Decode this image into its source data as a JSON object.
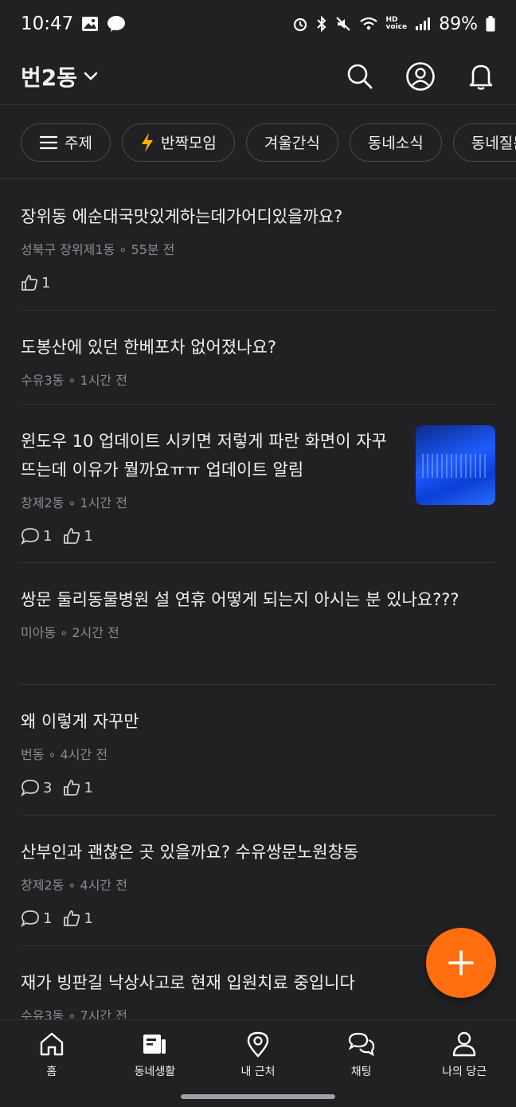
{
  "status": {
    "time": "10:47",
    "network": "HD\nvoice",
    "battery": "89%"
  },
  "header": {
    "location": "번2동"
  },
  "chips": [
    {
      "label": "주제",
      "icon": "menu-icon"
    },
    {
      "label": "반짝모임",
      "icon": "lightning-icon"
    },
    {
      "label": "겨울간식"
    },
    {
      "label": "동네소식"
    },
    {
      "label": "동네질문"
    }
  ],
  "posts": [
    {
      "title": "장위동 에순대국맛있게하는데가어디있을까요?",
      "meta": "성북구 장위제1동 ∘ 55분 전",
      "comments": "",
      "likes": "1"
    },
    {
      "title": "도봉산에 있던 한베포차 없어졌나요?",
      "meta": "수유3동 ∘ 1시간 전",
      "comments": "",
      "likes": ""
    },
    {
      "title": "윈도우 10 업데이트 시키면 저렇게 파란 화면이 자꾸 뜨는데 이유가 뭘까요ㅠㅠ 업데이트 알림",
      "meta": "창제2동 ∘ 1시간 전",
      "comments": "1",
      "likes": "1"
    },
    {
      "title": "쌍문 둘리동물병원 설 연휴 어떻게 되는지 아시는 분 있나요???",
      "meta": "미아동 ∘ 2시간 전",
      "comments": "",
      "likes": ""
    },
    {
      "title": "왜 이렇게 자꾸만",
      "meta": "번동 ∘ 4시간 전",
      "comments": "3",
      "likes": "1"
    },
    {
      "title": "산부인과 괜찮은 곳 있을까요? 수유쌍문노원창동",
      "meta": "창제2동 ∘ 4시간 전",
      "comments": "1",
      "likes": "1"
    },
    {
      "title": "재가 빙판길 낙상사고로 현재 입원치료 중입니다",
      "meta": "수유3동 ∘ 7시간 전",
      "comments": "",
      "likes": ""
    }
  ],
  "nav": [
    {
      "label": "홈"
    },
    {
      "label": "동네생활"
    },
    {
      "label": "내 근처"
    },
    {
      "label": "채팅"
    },
    {
      "label": "나의 당근"
    }
  ],
  "colors": {
    "background": "#212124",
    "accent": "#ff6f0f",
    "lightning": "#ffb300"
  }
}
